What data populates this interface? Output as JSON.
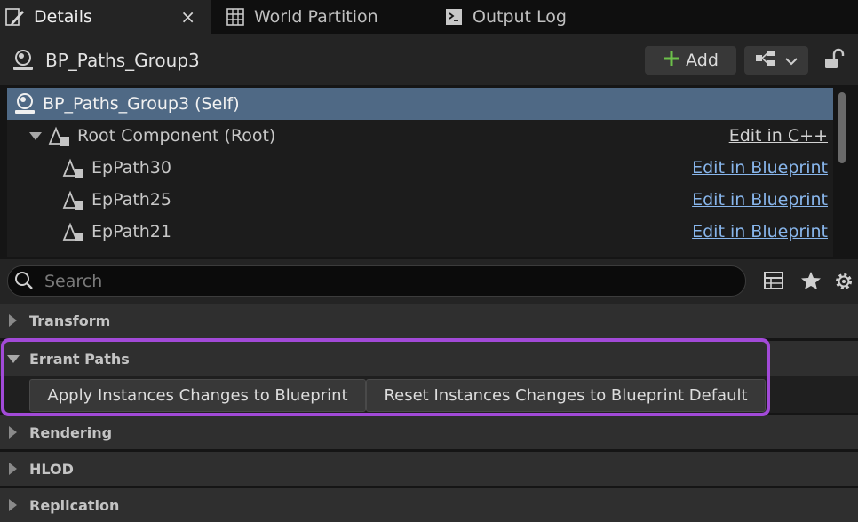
{
  "tabs": [
    {
      "label": "Details",
      "icon": "details-pencil-icon",
      "active": true
    },
    {
      "label": "World Partition",
      "icon": "world-partition-grid-icon",
      "active": false
    },
    {
      "label": "Output Log",
      "icon": "output-log-icon",
      "active": false
    }
  ],
  "tab_close_glyph": "×",
  "header": {
    "actor_name": "BP_Paths_Group3",
    "add_label": "Add"
  },
  "components": [
    {
      "label": "BP_Paths_Group3 (Self)",
      "action": "",
      "selected": true
    },
    {
      "label": "Root Component (Root)",
      "action": "Edit in C++"
    },
    {
      "label": "EpPath30",
      "action": "Edit in Blueprint"
    },
    {
      "label": "EpPath25",
      "action": "Edit in Blueprint"
    },
    {
      "label": "EpPath21",
      "action": "Edit in Blueprint"
    }
  ],
  "search": {
    "placeholder": "Search"
  },
  "categories": [
    {
      "label": "Transform",
      "expanded": false
    },
    {
      "label": "Errant Paths",
      "expanded": true
    },
    {
      "label": "Rendering",
      "expanded": false
    },
    {
      "label": "HLOD",
      "expanded": false
    },
    {
      "label": "Replication",
      "expanded": false
    }
  ],
  "errant_paths_buttons": {
    "apply": "Apply Instances Changes to Blueprint",
    "reset": "Reset Instances Changes to Blueprint Default"
  },
  "colors": {
    "accent_highlight": "#a24ad8",
    "selected_row": "#4f6985",
    "link": "#88b6ec",
    "add_plus": "#6cc04a"
  }
}
